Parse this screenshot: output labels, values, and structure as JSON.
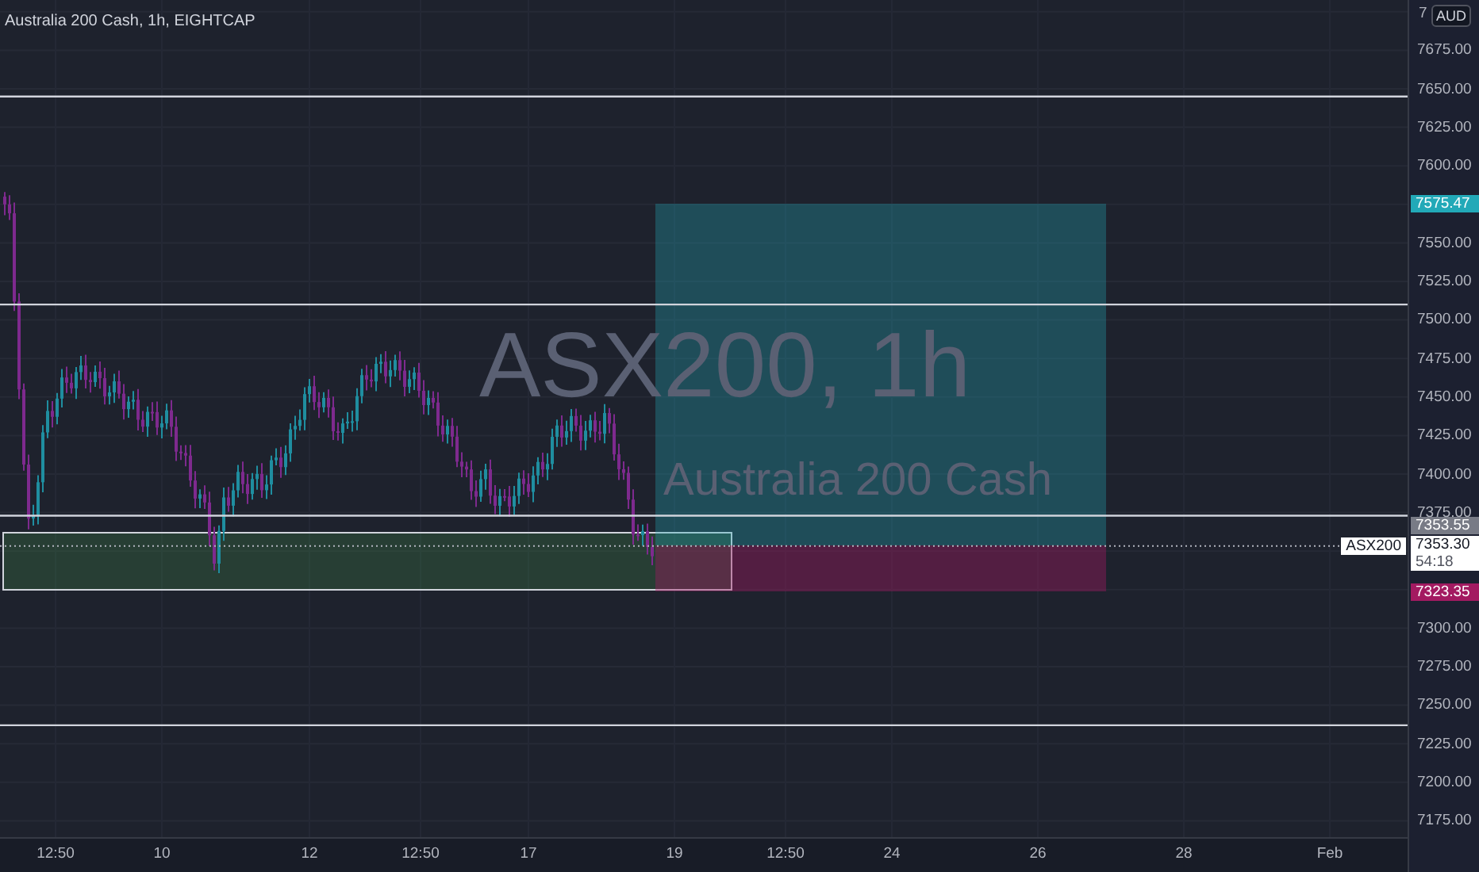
{
  "header": {
    "title": "Australia 200 Cash, 1h, EIGHTCAP"
  },
  "watermark": {
    "symbol": "ASX200, 1h",
    "description": "Australia 200 Cash"
  },
  "price_axis": {
    "clipped_label": "7",
    "currency": "AUD",
    "labels": [
      "7675.00",
      "7650.00",
      "7625.00",
      "7600.00",
      "7550.00",
      "7525.00",
      "7500.00",
      "7475.00",
      "7450.00",
      "7425.00",
      "7400.00",
      "7375.00",
      "7300.00",
      "7275.00",
      "7250.00",
      "7225.00",
      "7200.00",
      "7175.00"
    ]
  },
  "markers": [
    {
      "kind": "target",
      "text": "7575.47",
      "color": "#22a9b8"
    },
    {
      "kind": "high",
      "text": "7353.55",
      "color": "#787b86"
    },
    {
      "kind": "last",
      "text": "7353.30",
      "countdown": "54:18",
      "symbol": "ASX200",
      "color": "#ffffff"
    },
    {
      "kind": "stop",
      "text": "7323.35",
      "color": "#a31a61"
    }
  ],
  "time_axis": {
    "labels": [
      "12:50",
      "10",
      "12",
      "12:50",
      "17",
      "19",
      "12:50",
      "24",
      "26",
      "28",
      "Feb"
    ]
  }
}
